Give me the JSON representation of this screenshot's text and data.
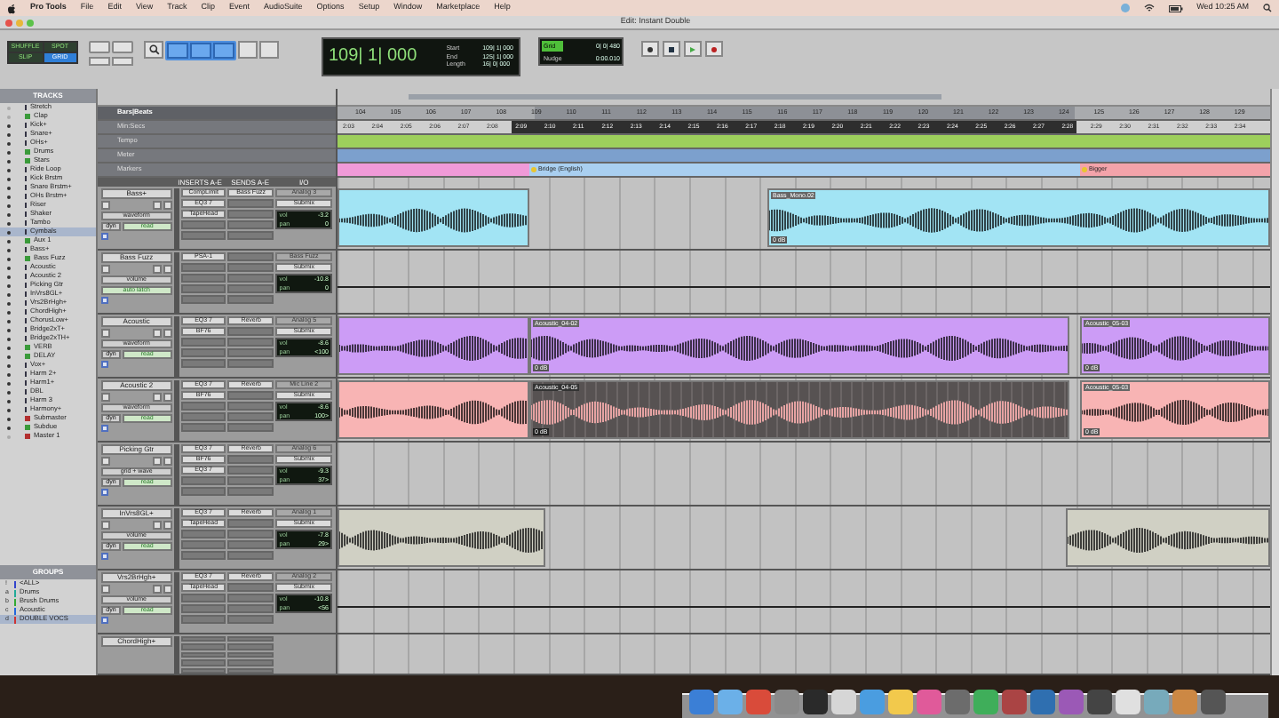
{
  "menu_bar": {
    "app": "Pro Tools",
    "menus": [
      "File",
      "Edit",
      "View",
      "Track",
      "Clip",
      "Event",
      "AudioSuite",
      "Options",
      "Setup",
      "Window",
      "Marketplace",
      "Help"
    ],
    "clock": "Wed 10:25 AM"
  },
  "window": {
    "title": "Edit: Instant Double"
  },
  "toolbar": {
    "edit_modes": [
      {
        "label": "SHUFFLE",
        "selected": false
      },
      {
        "label": "SPOT",
        "selected": false
      },
      {
        "label": "SLIP",
        "selected": false
      },
      {
        "label": "GRID",
        "selected": true
      }
    ],
    "counter": "109| 1| 000",
    "selection": [
      {
        "label": "Start",
        "value": "109| 1| 000"
      },
      {
        "label": "End",
        "value": "125| 1| 000"
      },
      {
        "label": "Length",
        "value": "16| 0| 000"
      }
    ],
    "grid": {
      "label": "Grid",
      "value": "0| 0| 480"
    },
    "nudge": {
      "label": "Nudge",
      "value": "0:00.010"
    }
  },
  "tracks_list": {
    "title": "TRACKS",
    "items": [
      {
        "name": "Stretch",
        "kind": "audio",
        "shown": false,
        "selected": false
      },
      {
        "name": "Clap",
        "kind": "aux",
        "shown": false,
        "selected": false
      },
      {
        "name": "Kick+",
        "kind": "audio",
        "shown": true,
        "selected": false
      },
      {
        "name": "Snare+",
        "kind": "audio",
        "shown": true,
        "selected": false
      },
      {
        "name": "OHs+",
        "kind": "audio",
        "shown": true,
        "selected": false
      },
      {
        "name": "Drums",
        "kind": "aux",
        "shown": true,
        "selected": false
      },
      {
        "name": "Stars",
        "kind": "aux",
        "shown": true,
        "selected": false
      },
      {
        "name": "Ride Loop",
        "kind": "audio",
        "shown": true,
        "selected": false
      },
      {
        "name": "Kick Brstm",
        "kind": "audio",
        "shown": true,
        "selected": false
      },
      {
        "name": "Snare Brstm+",
        "kind": "audio",
        "shown": true,
        "selected": false
      },
      {
        "name": "OHs Brstm+",
        "kind": "audio",
        "shown": true,
        "selected": false
      },
      {
        "name": "Riser",
        "kind": "audio",
        "shown": true,
        "selected": false
      },
      {
        "name": "Shaker",
        "kind": "audio",
        "shown": true,
        "selected": false
      },
      {
        "name": "Tambo",
        "kind": "audio",
        "shown": true,
        "selected": false
      },
      {
        "name": "Cymbals",
        "kind": "audio",
        "shown": true,
        "selected": true
      },
      {
        "name": "Aux 1",
        "kind": "aux",
        "shown": true,
        "selected": false
      },
      {
        "name": "Bass+",
        "kind": "audio",
        "shown": true,
        "selected": false
      },
      {
        "name": "Bass Fuzz",
        "kind": "aux",
        "shown": true,
        "selected": false
      },
      {
        "name": "Acoustic",
        "kind": "audio",
        "shown": true,
        "selected": false
      },
      {
        "name": "Acoustic 2",
        "kind": "audio",
        "shown": true,
        "selected": false
      },
      {
        "name": "Picking Gtr",
        "kind": "audio",
        "shown": true,
        "selected": false
      },
      {
        "name": "InVrs8GL+",
        "kind": "audio",
        "shown": true,
        "selected": false
      },
      {
        "name": "Vrs2BrHgh+",
        "kind": "audio",
        "shown": true,
        "selected": false
      },
      {
        "name": "ChordHigh+",
        "kind": "audio",
        "shown": true,
        "selected": false
      },
      {
        "name": "ChorusLow+",
        "kind": "audio",
        "shown": true,
        "selected": false
      },
      {
        "name": "Bridge2xT+",
        "kind": "audio",
        "shown": true,
        "selected": false
      },
      {
        "name": "Bridge2xTH+",
        "kind": "audio",
        "shown": true,
        "selected": false
      },
      {
        "name": "VERB",
        "kind": "aux",
        "shown": true,
        "selected": false
      },
      {
        "name": "DELAY",
        "kind": "aux",
        "shown": true,
        "selected": false
      },
      {
        "name": "Vox+",
        "kind": "audio",
        "shown": true,
        "selected": false
      },
      {
        "name": "Harm 2+",
        "kind": "audio",
        "shown": true,
        "selected": false
      },
      {
        "name": "Harm1+",
        "kind": "audio",
        "shown": true,
        "selected": false
      },
      {
        "name": "DBL",
        "kind": "audio",
        "shown": true,
        "selected": false
      },
      {
        "name": "Harm 3",
        "kind": "audio",
        "shown": true,
        "selected": false
      },
      {
        "name": "Harmony+",
        "kind": "audio",
        "shown": true,
        "selected": false
      },
      {
        "name": "Submaster",
        "kind": "master",
        "shown": true,
        "selected": false
      },
      {
        "name": "Subdue",
        "kind": "aux",
        "shown": true,
        "selected": false
      },
      {
        "name": "Master 1",
        "kind": "master",
        "shown": false,
        "selected": false
      }
    ]
  },
  "groups_list": {
    "title": "GROUPS",
    "items": [
      {
        "id": "!",
        "name": "<ALL>",
        "color": "#3344cc",
        "selected": false
      },
      {
        "id": "a",
        "name": "Drums",
        "color": "#22aa99",
        "selected": false
      },
      {
        "id": "b",
        "name": "Brush Drums",
        "color": "#33aa33",
        "selected": false
      },
      {
        "id": "c",
        "name": "Acoustic",
        "color": "#2266dd",
        "selected": false
      },
      {
        "id": "d",
        "name": "DOUBLE VOCS",
        "color": "#cc3333",
        "selected": true
      }
    ]
  },
  "rulers": [
    {
      "name": "Bars|Beats",
      "selected": true
    },
    {
      "name": "Min:Secs",
      "selected": false
    },
    {
      "name": "Tempo",
      "selected": false
    },
    {
      "name": "Meter",
      "selected": false
    },
    {
      "name": "Markers",
      "selected": false
    }
  ],
  "bars": [
    "104",
    "105",
    "106",
    "107",
    "108",
    "109",
    "110",
    "111",
    "112",
    "113",
    "114",
    "115",
    "116",
    "117",
    "118",
    "119",
    "120",
    "121",
    "122",
    "123",
    "124",
    "125",
    "126",
    "127",
    "128",
    "129"
  ],
  "min_secs": [
    "2:03",
    "2:04",
    "2:05",
    "2:06",
    "2:07",
    "2:08",
    "2:09",
    "2:10",
    "2:11",
    "2:12",
    "2:13",
    "2:14",
    "2:15",
    "2:16",
    "2:17",
    "2:18",
    "2:19",
    "2:20",
    "2:21",
    "2:22",
    "2:23",
    "2:24",
    "2:25",
    "2:26",
    "2:27",
    "2:28",
    "2:29",
    "2:30",
    "2:31",
    "2:32",
    "2:33",
    "2:34"
  ],
  "markers": [
    {
      "color": "#f09ad8"
    },
    {
      "name": "Bridge (English)",
      "color": "#a9cff0"
    },
    {
      "name": "Bigger",
      "color": "#f3a3aa"
    }
  ],
  "column_headers": [
    "INSERTS A-E",
    "SENDS A-E",
    "I/O"
  ],
  "tracks": [
    {
      "name": "Bass+",
      "color": "#a2e4f4",
      "view": "waveform",
      "automation": "read",
      "dyn": "dyn",
      "inserts": [
        "CompLimit",
        "EQ3 7",
        "TapeHead"
      ],
      "sends": [
        "Bass Fuzz"
      ],
      "input": "Analog 3",
      "output": "Submix",
      "vol_label": "vol",
      "vol": "-3.2",
      "pan_label": "pan",
      "pan": "0",
      "clips": [
        {
          "selected": false
        },
        {
          "name": "Bass_Mono.02",
          "gain": "0 dB",
          "selected": false
        }
      ]
    },
    {
      "name": "Bass Fuzz",
      "view": "volume",
      "automation": "auto latch",
      "inserts": [
        "PSA-1"
      ],
      "input": "Bass Fuzz",
      "output": "Submix",
      "vol_label": "vol",
      "vol": "-10.8",
      "pan_label": "pan",
      "pan": "0"
    },
    {
      "name": "Acoustic",
      "color": "#cc9cf6",
      "view": "waveform",
      "automation": "read",
      "dyn": "dyn",
      "inserts": [
        "EQ3 7",
        "BF76"
      ],
      "sends": [
        "Reverb"
      ],
      "input": "Analog 5",
      "output": "Submix",
      "vol_label": "vol",
      "vol": "-8.6",
      "pan_label": "pan",
      "pan": "<100",
      "clips": [
        {
          "selected": false
        },
        {
          "name": "Acoustic_04-02",
          "gain": "0 dB",
          "selected": false
        },
        {
          "name": "Acoustic_05-03",
          "gain": "0 dB",
          "selected": false
        }
      ]
    },
    {
      "name": "Acoustic 2",
      "color": "#f8b4b4",
      "view": "waveform",
      "automation": "read",
      "dyn": "dyn",
      "inserts": [
        "EQ3 7",
        "BF76"
      ],
      "sends": [
        "Reverb"
      ],
      "input": "Mic Line 2",
      "output": "Submix",
      "vol_label": "vol",
      "vol": "-8.6",
      "pan_label": "pan",
      "pan": "100>",
      "clips": [
        {
          "selected": false
        },
        {
          "name": "Acoustic_04-05",
          "gain": "0 dB",
          "selected": true
        },
        {
          "name": "Acoustic_05-03",
          "gain": "0 dB",
          "selected": false
        }
      ]
    },
    {
      "name": "Picking Gtr",
      "view": "grid + wave",
      "automation": "read",
      "dyn": "dyn",
      "inserts": [
        "EQ3 7",
        "BF76",
        "EQ3 7"
      ],
      "sends": [
        "Reverb"
      ],
      "input": "Analog 6",
      "output": "Submix",
      "vol_label": "vol",
      "vol": "-9.3",
      "pan_label": "pan",
      "pan": "37>"
    },
    {
      "name": "InVrs8GL+",
      "color": "#d0d0c4",
      "view": "volume",
      "automation": "read",
      "dyn": "dyn",
      "inserts": [
        "EQ3 7",
        "TapeHead"
      ],
      "sends": [
        "Reverb"
      ],
      "input": "Analog 1",
      "output": "Submix",
      "vol_label": "vol",
      "vol": "-7.8",
      "pan_label": "pan",
      "pan": "29>",
      "clips": [
        {
          "selected": false
        },
        {
          "selected": false
        }
      ]
    },
    {
      "name": "Vrs2BrHgh+",
      "view": "volume",
      "automation": "read",
      "dyn": "dyn",
      "inserts": [
        "EQ3 7",
        "TapeHead"
      ],
      "sends": [
        "Reverb"
      ],
      "input": "Analog 2",
      "output": "Submix",
      "vol_label": "vol",
      "vol": "-10.8",
      "pan_label": "pan",
      "pan": "<56"
    },
    {
      "name": "ChordHigh+"
    }
  ]
}
